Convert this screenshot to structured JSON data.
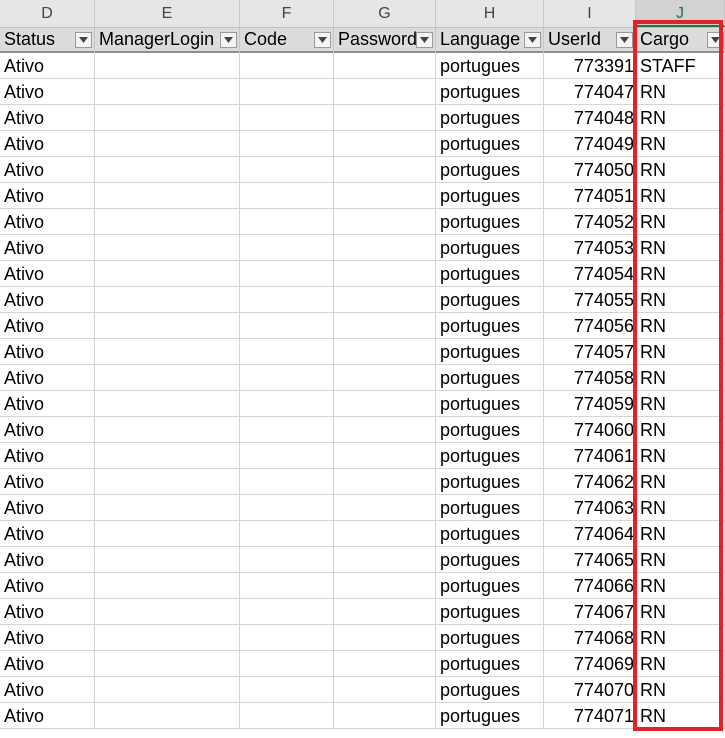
{
  "column_letters": [
    "D",
    "E",
    "F",
    "G",
    "H",
    "I",
    "J"
  ],
  "header": {
    "status": "Status",
    "manager_login": "ManagerLogin",
    "code": "Code",
    "password": "Password",
    "language": "Language",
    "user_id": "UserId",
    "cargo": "Cargo"
  },
  "rows": [
    {
      "status": "Ativo",
      "manager_login": "",
      "code": "",
      "password": "",
      "language": "portugues",
      "user_id": "773391",
      "cargo": "STAFF"
    },
    {
      "status": "Ativo",
      "manager_login": "",
      "code": "",
      "password": "",
      "language": "portugues",
      "user_id": "774047",
      "cargo": "RN"
    },
    {
      "status": "Ativo",
      "manager_login": "",
      "code": "",
      "password": "",
      "language": "portugues",
      "user_id": "774048",
      "cargo": "RN"
    },
    {
      "status": "Ativo",
      "manager_login": "",
      "code": "",
      "password": "",
      "language": "portugues",
      "user_id": "774049",
      "cargo": "RN"
    },
    {
      "status": "Ativo",
      "manager_login": "",
      "code": "",
      "password": "",
      "language": "portugues",
      "user_id": "774050",
      "cargo": "RN"
    },
    {
      "status": "Ativo",
      "manager_login": "",
      "code": "",
      "password": "",
      "language": "portugues",
      "user_id": "774051",
      "cargo": "RN"
    },
    {
      "status": "Ativo",
      "manager_login": "",
      "code": "",
      "password": "",
      "language": "portugues",
      "user_id": "774052",
      "cargo": "RN"
    },
    {
      "status": "Ativo",
      "manager_login": "",
      "code": "",
      "password": "",
      "language": "portugues",
      "user_id": "774053",
      "cargo": "RN"
    },
    {
      "status": "Ativo",
      "manager_login": "",
      "code": "",
      "password": "",
      "language": "portugues",
      "user_id": "774054",
      "cargo": "RN"
    },
    {
      "status": "Ativo",
      "manager_login": "",
      "code": "",
      "password": "",
      "language": "portugues",
      "user_id": "774055",
      "cargo": "RN"
    },
    {
      "status": "Ativo",
      "manager_login": "",
      "code": "",
      "password": "",
      "language": "portugues",
      "user_id": "774056",
      "cargo": "RN"
    },
    {
      "status": "Ativo",
      "manager_login": "",
      "code": "",
      "password": "",
      "language": "portugues",
      "user_id": "774057",
      "cargo": "RN"
    },
    {
      "status": "Ativo",
      "manager_login": "",
      "code": "",
      "password": "",
      "language": "portugues",
      "user_id": "774058",
      "cargo": "RN"
    },
    {
      "status": "Ativo",
      "manager_login": "",
      "code": "",
      "password": "",
      "language": "portugues",
      "user_id": "774059",
      "cargo": "RN"
    },
    {
      "status": "Ativo",
      "manager_login": "",
      "code": "",
      "password": "",
      "language": "portugues",
      "user_id": "774060",
      "cargo": "RN"
    },
    {
      "status": "Ativo",
      "manager_login": "",
      "code": "",
      "password": "",
      "language": "portugues",
      "user_id": "774061",
      "cargo": "RN"
    },
    {
      "status": "Ativo",
      "manager_login": "",
      "code": "",
      "password": "",
      "language": "portugues",
      "user_id": "774062",
      "cargo": "RN"
    },
    {
      "status": "Ativo",
      "manager_login": "",
      "code": "",
      "password": "",
      "language": "portugues",
      "user_id": "774063",
      "cargo": "RN"
    },
    {
      "status": "Ativo",
      "manager_login": "",
      "code": "",
      "password": "",
      "language": "portugues",
      "user_id": "774064",
      "cargo": "RN"
    },
    {
      "status": "Ativo",
      "manager_login": "",
      "code": "",
      "password": "",
      "language": "portugues",
      "user_id": "774065",
      "cargo": "RN"
    },
    {
      "status": "Ativo",
      "manager_login": "",
      "code": "",
      "password": "",
      "language": "portugues",
      "user_id": "774066",
      "cargo": "RN"
    },
    {
      "status": "Ativo",
      "manager_login": "",
      "code": "",
      "password": "",
      "language": "portugues",
      "user_id": "774067",
      "cargo": "RN"
    },
    {
      "status": "Ativo",
      "manager_login": "",
      "code": "",
      "password": "",
      "language": "portugues",
      "user_id": "774068",
      "cargo": "RN"
    },
    {
      "status": "Ativo",
      "manager_login": "",
      "code": "",
      "password": "",
      "language": "portugues",
      "user_id": "774069",
      "cargo": "RN"
    },
    {
      "status": "Ativo",
      "manager_login": "",
      "code": "",
      "password": "",
      "language": "portugues",
      "user_id": "774070",
      "cargo": "RN"
    },
    {
      "status": "Ativo",
      "manager_login": "",
      "code": "",
      "password": "",
      "language": "portugues",
      "user_id": "774071",
      "cargo": "RN"
    }
  ],
  "colors": {
    "highlight_border": "#e32127",
    "selected_column_accent": "#217346"
  },
  "icons": {
    "filter": "filter-dropdown-arrow-icon"
  }
}
